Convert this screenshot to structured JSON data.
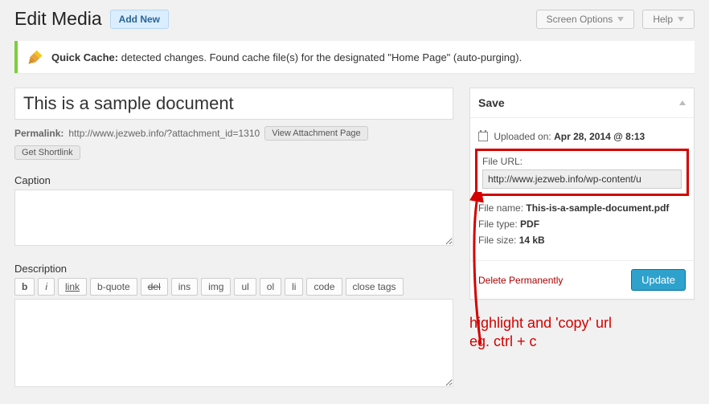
{
  "header": {
    "title": "Edit Media",
    "add_new": "Add New",
    "screen_options": "Screen Options",
    "help": "Help"
  },
  "notice": {
    "strong": "Quick Cache:",
    "text": " detected changes. Found cache file(s) for the designated \"Home Page\" (auto-purging)."
  },
  "post": {
    "title_value": "This is a sample document",
    "permalink_label": "Permalink:",
    "permalink_url": "http://www.jezweb.info/?attachment_id=1310",
    "view_attachment": "View Attachment Page",
    "get_shortlink": "Get Shortlink",
    "caption_label": "Caption",
    "description_label": "Description",
    "qt": {
      "b": "b",
      "i": "i",
      "link": "link",
      "bquote": "b-quote",
      "del": "del",
      "ins": "ins",
      "img": "img",
      "ul": "ul",
      "ol": "ol",
      "li": "li",
      "code": "code",
      "close": "close tags"
    }
  },
  "save": {
    "heading": "Save",
    "uploaded_label": "Uploaded on:",
    "uploaded_value": "Apr 28, 2014 @ 8:13",
    "file_url_label": "File URL:",
    "file_url_value": "http://www.jezweb.info/wp-content/u",
    "file_name_label": "File name:",
    "file_name_value": "This-is-a-sample-document.pdf",
    "file_type_label": "File type:",
    "file_type_value": "PDF",
    "file_size_label": "File size:",
    "file_size_value": "14 kB",
    "delete": "Delete Permanently",
    "update": "Update"
  },
  "annotation": {
    "line1": "highlight and 'copy' url",
    "line2": "eg. ctrl + c"
  }
}
